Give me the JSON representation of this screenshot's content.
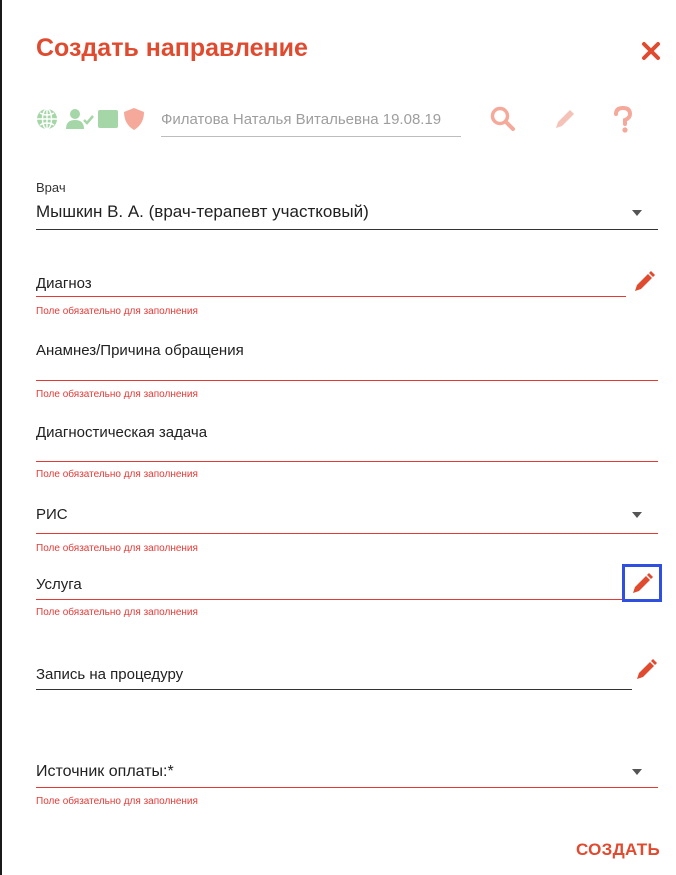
{
  "dialog": {
    "title": "Создать направление",
    "close_icon": "close-icon",
    "accent_color": "#e04a2f",
    "error_color": "#e53935"
  },
  "patient": {
    "icons": [
      "globe-icon",
      "user-check-icon",
      "card-icon",
      "shield-icon"
    ],
    "value": "Филатова Наталья Витальевна 19.08.19",
    "actions": [
      "search-icon",
      "pencil-icon",
      "help-icon"
    ]
  },
  "form": {
    "doctor": {
      "label": "Врач",
      "value": "Мышкин В. А. (врач-терапевт участковый)"
    },
    "diagnosis": {
      "label": "Диагноз",
      "error": "Поле обязательно для заполнения"
    },
    "anamnesis": {
      "label": "Анамнез/Причина обращения",
      "error": "Поле обязательно для заполнения"
    },
    "task": {
      "label": "Диагностическая задача",
      "error": "Поле обязательно для заполнения"
    },
    "ris": {
      "label": "РИС",
      "error": "Поле обязательно для заполнения"
    },
    "service": {
      "label": "Услуга",
      "error": "Поле обязательно для заполнения"
    },
    "procedure": {
      "label": "Запись на процедуру"
    },
    "payment": {
      "label": "Источник оплаты:*",
      "error": "Поле обязательно для заполнения"
    }
  },
  "actions": {
    "create_label": "СОЗДАТЬ"
  }
}
